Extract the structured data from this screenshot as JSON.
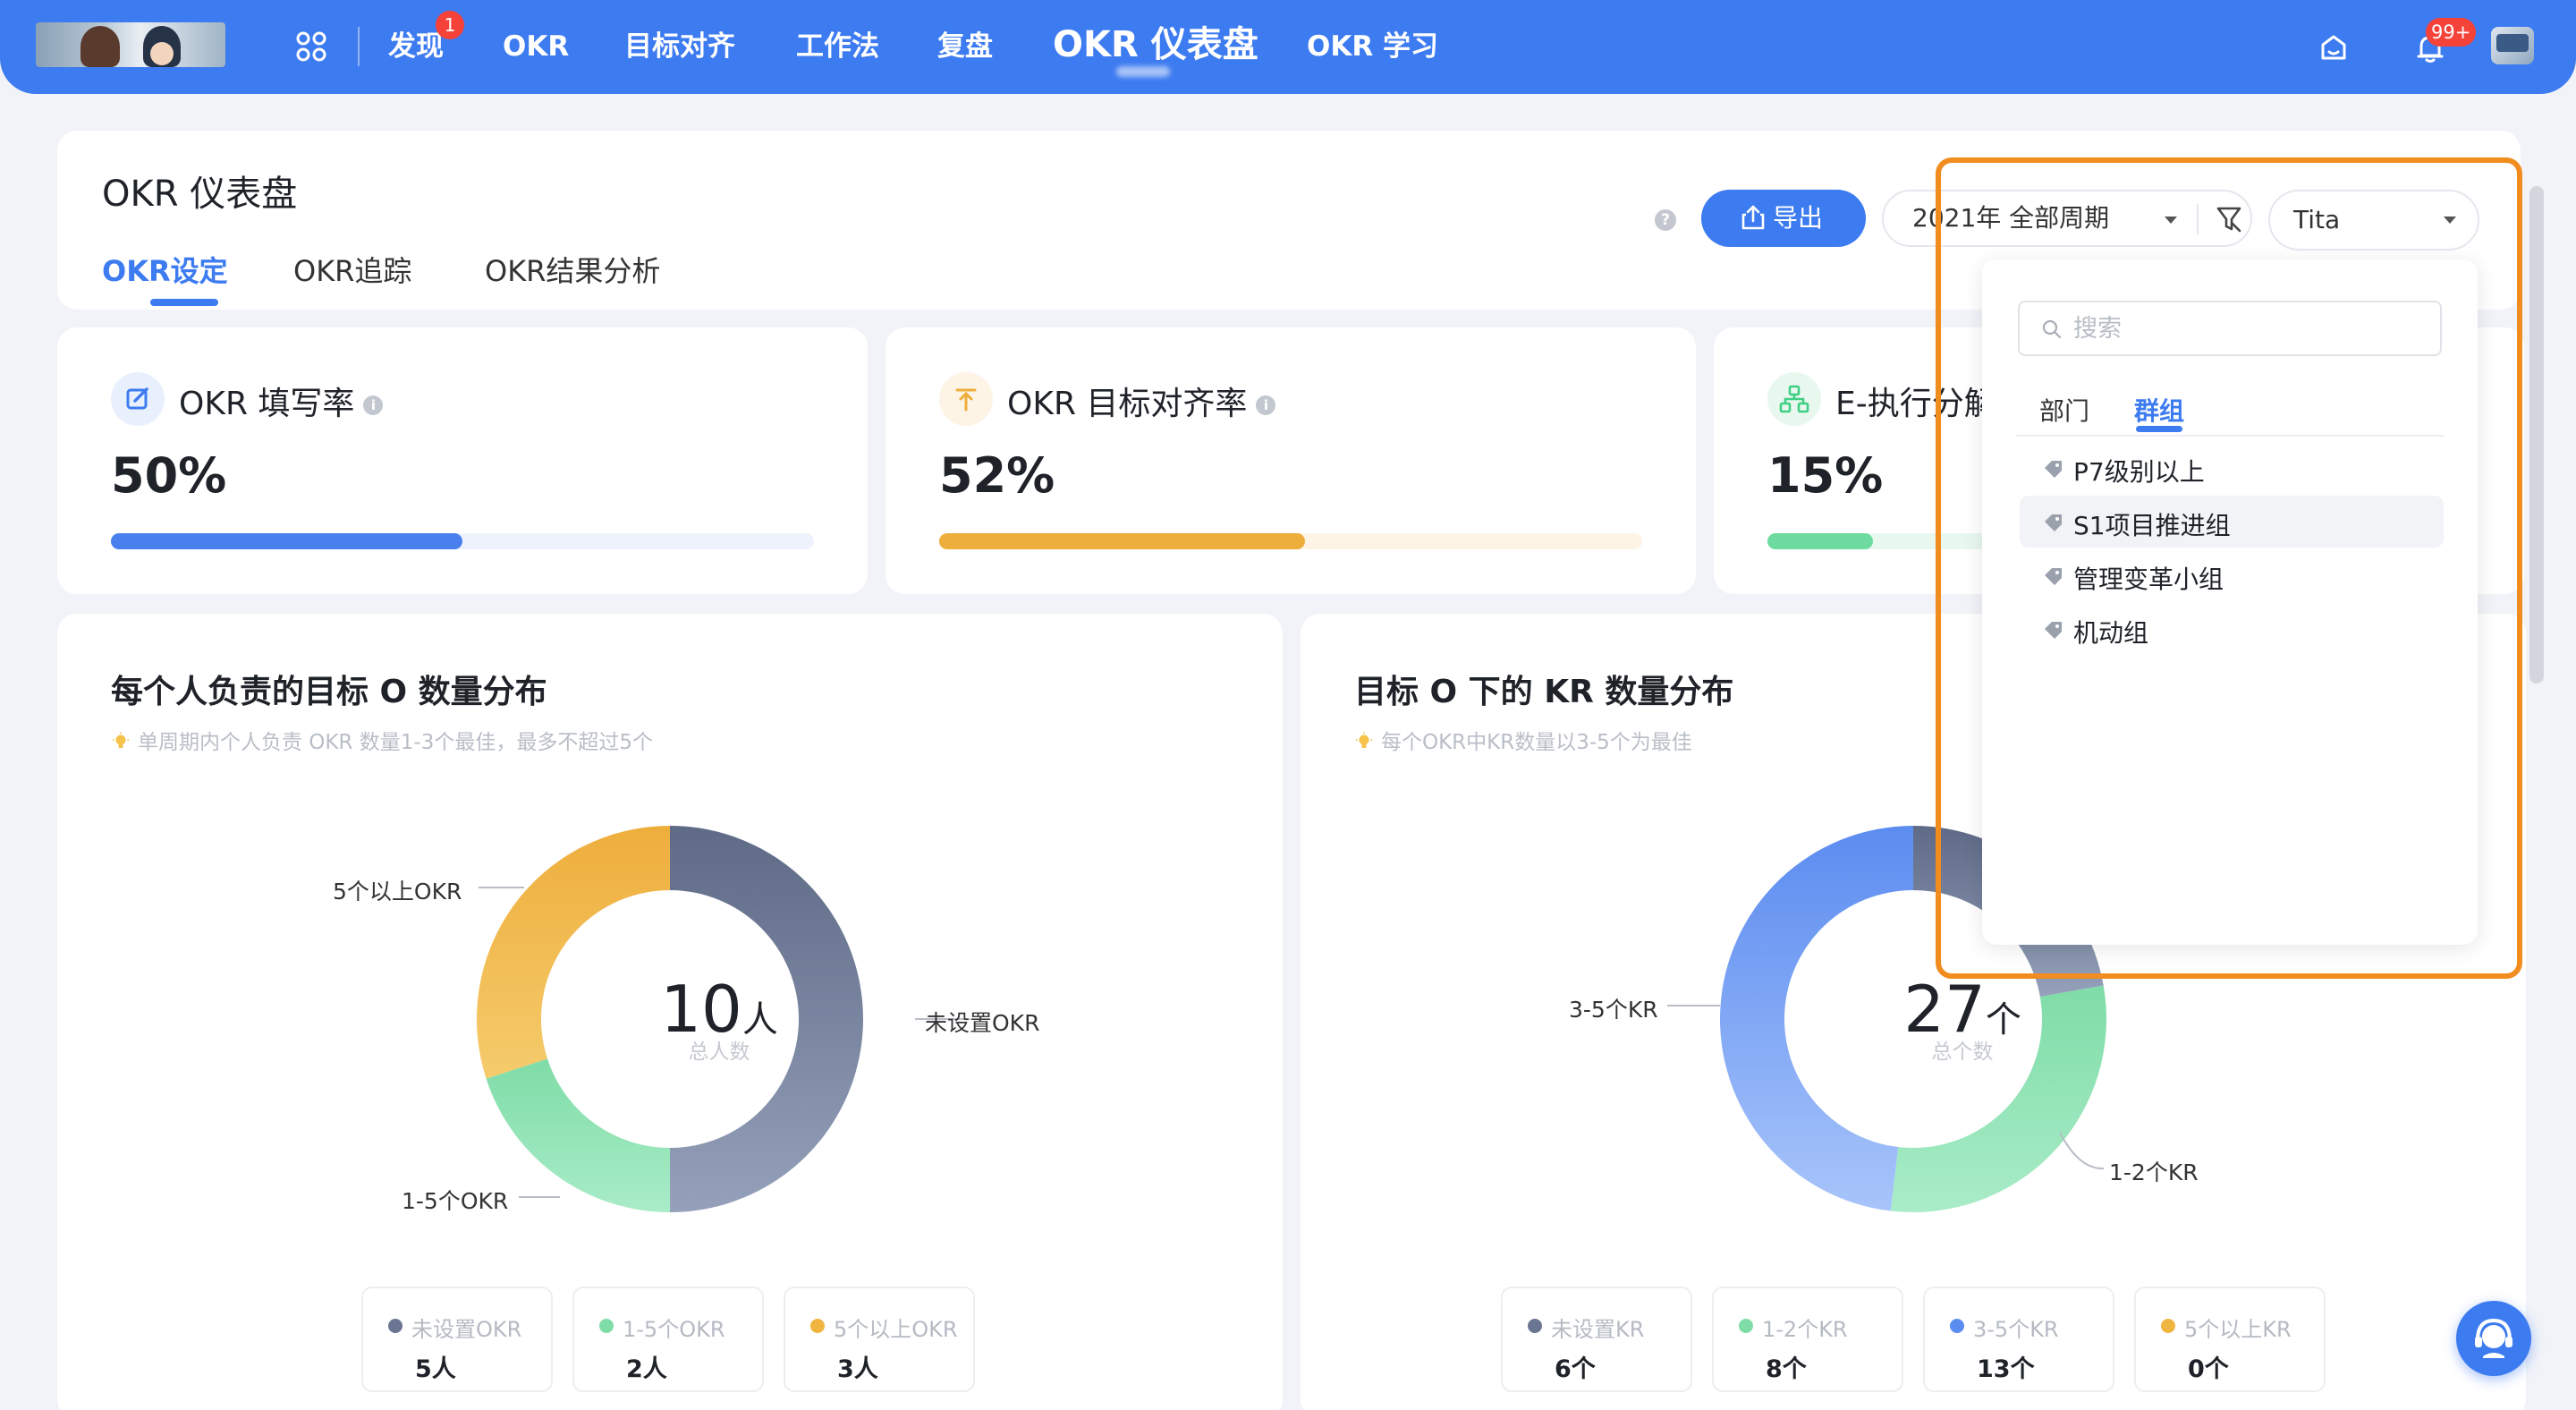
{
  "nav": {
    "badge_discover": "1",
    "items": [
      "发现",
      "OKR",
      "目标对齐",
      "工作法",
      "复盘",
      "OKR 仪表盘",
      "OKR 学习"
    ],
    "bell_badge": "99+"
  },
  "header": {
    "title": "OKR 仪表盘",
    "tabs": [
      "OKR设定",
      "OKR追踪",
      "OKR结果分析"
    ],
    "active_tab": "OKR设定",
    "help": "?",
    "export_label": "导出",
    "period_label": "2021年 全部周期",
    "scope_label": "Tita"
  },
  "stats": [
    {
      "title": "OKR 填写率",
      "value": "50%",
      "progress": 0.5,
      "color": "#4a80ee",
      "track": "#edf2fc"
    },
    {
      "title": "OKR 目标对齐率",
      "value": "52%",
      "progress": 0.52,
      "color": "#eeae3c",
      "track": "#fdf4e6"
    },
    {
      "title": "E-执行分解",
      "value": "15%",
      "progress": 0.15,
      "color": "#6ddb9f",
      "track": "#e8f8ef"
    }
  ],
  "charts": [
    {
      "title": "每个人负责的目标 O 数量分布",
      "tip": "单周期内个人负责 OKR 数量1-3个最佳，最多不超过5个",
      "center_value": "10",
      "center_unit": "人",
      "center_label": "总人数",
      "legend": [
        {
          "name": "未设置OKR",
          "value": "5人",
          "color": "#6a7591"
        },
        {
          "name": "1-5个OKR",
          "value": "2人",
          "color": "#7fdca7"
        },
        {
          "name": "5个以上OKR",
          "value": "3人",
          "color": "#f0b540"
        }
      ],
      "callouts": [
        "5个以上OKR",
        "未设置OKR",
        "1-5个OKR"
      ]
    },
    {
      "title": "目标 O 下的 KR 数量分布",
      "tip": "每个OKR中KR数量以3-5个为最佳",
      "center_value": "27",
      "center_unit": "个",
      "center_label": "总个数",
      "legend": [
        {
          "name": "未设置KR",
          "value": "6个",
          "color": "#6a7591"
        },
        {
          "name": "1-2个KR",
          "value": "8个",
          "color": "#7fdca7"
        },
        {
          "name": "3-5个KR",
          "value": "13个",
          "color": "#5b8cf0"
        },
        {
          "name": "5个以上KR",
          "value": "0个",
          "color": "#f0b540"
        }
      ],
      "callouts": [
        "3-5个KR",
        "1-2个KR"
      ]
    }
  ],
  "chart_data": [
    {
      "type": "pie",
      "title": "每个人负责的目标 O 数量分布",
      "categories": [
        "未设置OKR",
        "1-5个OKR",
        "5个以上OKR"
      ],
      "values": [
        5,
        2,
        3
      ]
    },
    {
      "type": "pie",
      "title": "目标 O 下的 KR 数量分布",
      "categories": [
        "未设置KR",
        "1-2个KR",
        "3-5个KR",
        "5个以上KR"
      ],
      "values": [
        6,
        8,
        13,
        0
      ]
    }
  ],
  "dropdown": {
    "search_placeholder": "搜索",
    "tabs": [
      "部门",
      "群组"
    ],
    "active_tab": "群组",
    "items": [
      "P7级别以上",
      "S1项目推进组",
      "管理变革小组",
      "机动组"
    ],
    "hovered_item": "S1项目推进组"
  }
}
